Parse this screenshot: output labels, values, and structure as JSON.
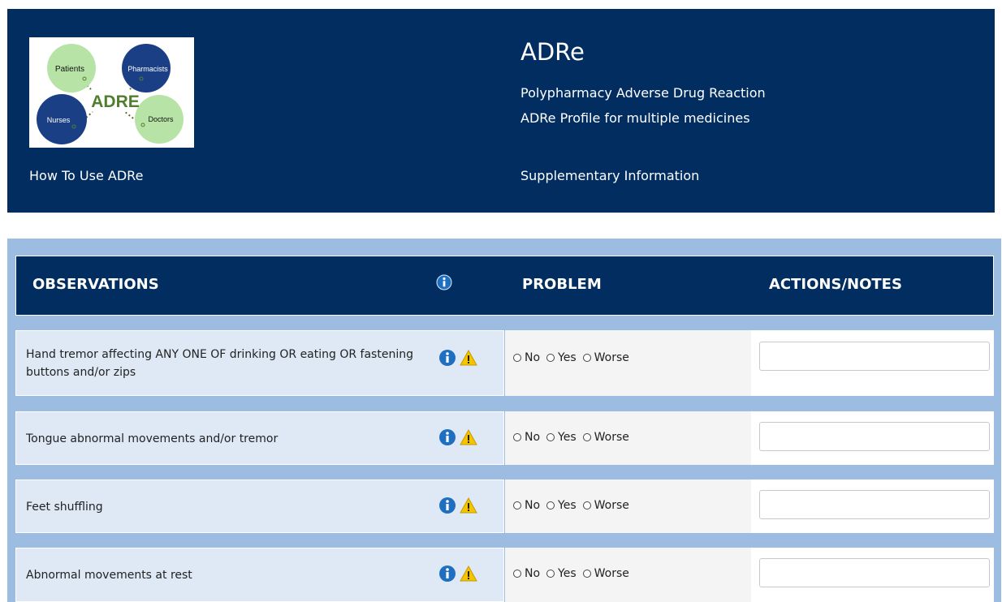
{
  "header": {
    "logo": {
      "circle_labels": [
        "Patients",
        "Pharmacists",
        "Nurses",
        "Doctors"
      ],
      "wordmark": "ADRE"
    },
    "how_to_link": "How To Use ADRe",
    "title": "ADRe",
    "subtitle_1": "Polypharmacy Adverse Drug Reaction",
    "subtitle_2": "ADRe Profile for multiple medicines",
    "supplementary_link": "Supplementary Information"
  },
  "table": {
    "col_observations": "OBSERVATIONS",
    "col_problem": "PROBLEM",
    "col_actions": "ACTIONS/NOTES",
    "radio_labels": {
      "no": "No",
      "yes": "Yes",
      "worse": "Worse"
    },
    "rows": [
      {
        "observation": "Hand tremor affecting ANY ONE OF drinking OR eating OR fastening buttons and/or zips",
        "note": ""
      },
      {
        "observation": "Tongue abnormal movements and/or tremor",
        "note": ""
      },
      {
        "observation": "Feet shuffling",
        "note": ""
      },
      {
        "observation": "Abnormal movements at rest",
        "note": ""
      }
    ]
  },
  "icons": {
    "info": "info-icon",
    "warning": "warning-icon"
  },
  "colors": {
    "header_bg": "#012d60",
    "panel_bg": "#9cbce1",
    "observation_cell_bg": "#dfe9f5",
    "info_blue": "#1f6fc1",
    "warning_yellow": "#f5c400"
  }
}
